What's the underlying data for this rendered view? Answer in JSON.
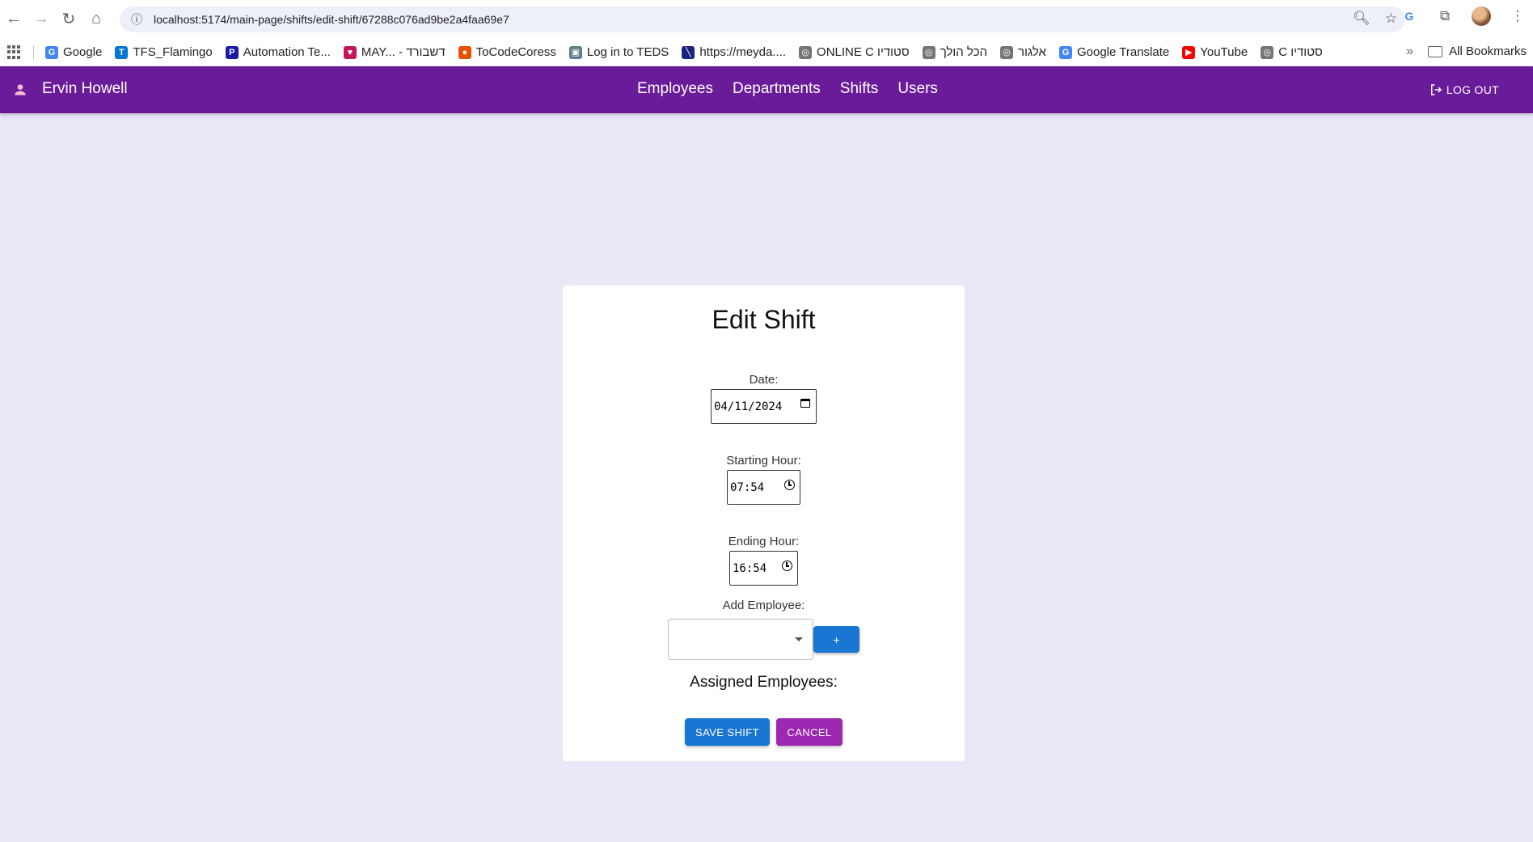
{
  "browser": {
    "url": "localhost:5174/main-page/shifts/edit-shift/67288c076ad9be2a4faa69e7",
    "bookmarks": [
      {
        "label": "Google",
        "color": "#4285f4",
        "glyph": "G"
      },
      {
        "label": "TFS_Flamingo",
        "color": "#0078d4",
        "glyph": "T"
      },
      {
        "label": "Automation Te...",
        "color": "#1a1aa6",
        "glyph": "P"
      },
      {
        "label": "MAY... - דשבורד",
        "color": "#c2185b",
        "glyph": "♥"
      },
      {
        "label": "ToCodeCoress",
        "color": "#e65100",
        "glyph": "●"
      },
      {
        "label": "Log in to TEDS",
        "color": "#607d8b",
        "glyph": "▣"
      },
      {
        "label": "https://meyda....",
        "color": "#1a237e",
        "glyph": "╲"
      },
      {
        "label": "ONLINE C סטודיו",
        "color": "#757575",
        "glyph": "◎"
      },
      {
        "label": "הכל הולך",
        "color": "#757575",
        "glyph": "◎"
      },
      {
        "label": "אלגור",
        "color": "#757575",
        "glyph": "◎"
      },
      {
        "label": "Google Translate",
        "color": "#4285f4",
        "glyph": "G"
      },
      {
        "label": "YouTube",
        "color": "#ff0000",
        "glyph": "▶"
      },
      {
        "label": "C סטודיו",
        "color": "#757575",
        "glyph": "◎"
      }
    ],
    "all_bookmarks": "All Bookmarks"
  },
  "header": {
    "user_name": "Ervin Howell",
    "nav": [
      "Employees",
      "Departments",
      "Shifts",
      "Users"
    ],
    "logout": "LOG OUT",
    "bg_color": "#6a1b9a"
  },
  "form": {
    "title": "Edit Shift",
    "date_label": "Date:",
    "date_value": "04/11/2024",
    "start_label": "Starting Hour:",
    "start_value": "07:54",
    "end_label": "Ending Hour:",
    "end_value": "16:54",
    "employee_label": "Add Employee:",
    "employee_selected": "",
    "add_button": "+",
    "assigned_title": "Assigned Employees:",
    "save_button": "SAVE SHIFT",
    "cancel_button": "CANCEL"
  }
}
